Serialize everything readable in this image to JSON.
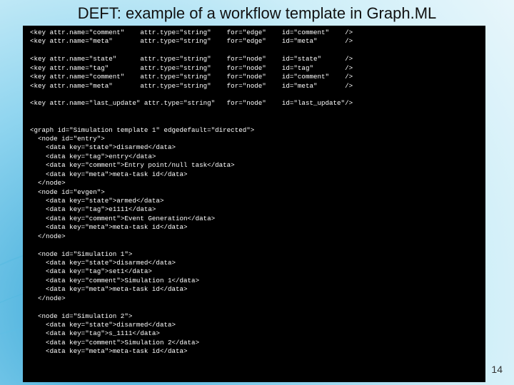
{
  "title": "DEFT: example of a workflow template in Graph.ML",
  "page_number": "14",
  "code_lines": [
    "<key attr.name=\"comment\"    attr.type=\"string\"    for=\"edge\"    id=\"comment\"    />",
    "<key attr.name=\"meta\"       attr.type=\"string\"    for=\"edge\"    id=\"meta\"       />",
    "",
    "<key attr.name=\"state\"      attr.type=\"string\"    for=\"node\"    id=\"state\"      />",
    "<key attr.name=\"tag\"        attr.type=\"string\"    for=\"node\"    id=\"tag\"        />",
    "<key attr.name=\"comment\"    attr.type=\"string\"    for=\"node\"    id=\"comment\"    />",
    "<key attr.name=\"meta\"       attr.type=\"string\"    for=\"node\"    id=\"meta\"       />",
    "",
    "<key attr.name=\"last_update\" attr.type=\"string\"   for=\"node\"    id=\"last_update\"/>",
    "",
    "",
    "<graph id=\"Simulation template 1\" edgedefault=\"directed\">",
    "  <node id=\"entry\">",
    "    <data key=\"state\">disarmed</data>",
    "    <data key=\"tag\">entry</data>",
    "    <data key=\"comment\">Entry point/null task</data>",
    "    <data key=\"meta\">meta-task id</data>",
    "  </node>",
    "  <node id=\"evgen\">",
    "    <data key=\"state\">armed</data>",
    "    <data key=\"tag\">e1111</data>",
    "    <data key=\"comment\">Event Generation</data>",
    "    <data key=\"meta\">meta-task id</data>",
    "  </node>",
    "",
    "  <node id=\"Simulation 1\">",
    "    <data key=\"state\">disarmed</data>",
    "    <data key=\"tag\">set1</data>",
    "    <data key=\"comment\">Simulation 1</data>",
    "    <data key=\"meta\">meta-task id</data>",
    "  </node>",
    "",
    "  <node id=\"Simulation 2\">",
    "    <data key=\"state\">disarmed</data>",
    "    <data key=\"tag\">s_1111</data>",
    "    <data key=\"comment\">Simulation 2</data>",
    "    <data key=\"meta\">meta-task id</data>",
    ""
  ]
}
